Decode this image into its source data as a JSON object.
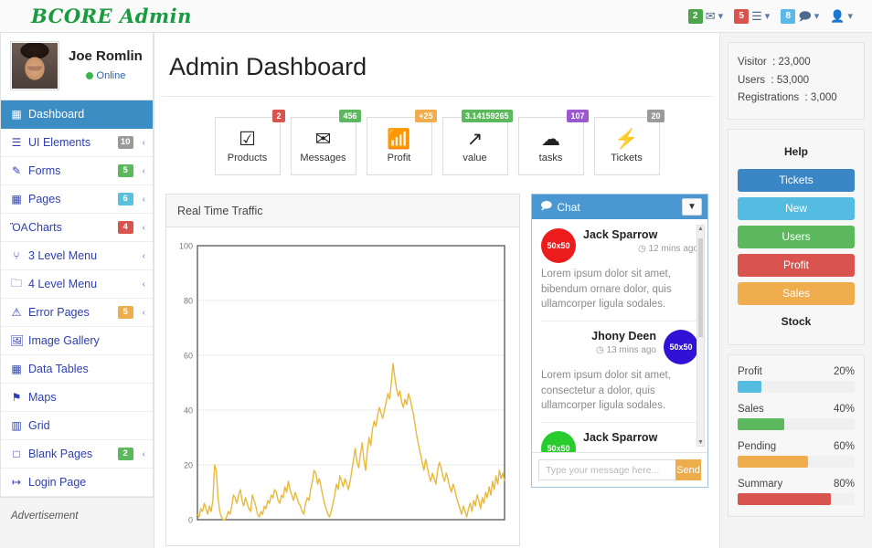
{
  "brand": "BCORE Admin",
  "topnav": [
    {
      "badge": "2",
      "badge_color": "#4ba54b",
      "icon": "envelope-icon",
      "glyph": "✉"
    },
    {
      "badge": "5",
      "badge_color": "#d9534f",
      "icon": "tasks-icon",
      "glyph": "☰"
    },
    {
      "badge": "8",
      "badge_color": "#5bb8e8",
      "icon": "comments-icon",
      "glyph": "὞9"
    },
    {
      "badge": "",
      "badge_color": "",
      "icon": "user-icon",
      "glyph": "♟"
    }
  ],
  "profile": {
    "name": "Joe Romlin",
    "status": "Online",
    "avatar": "user-avatar"
  },
  "sidebar": {
    "items": [
      {
        "label": "Dashboard",
        "icon": "grid-icon",
        "glyph": "▦",
        "badge": "",
        "badge_color": "",
        "caret": false,
        "active": true
      },
      {
        "label": "UI Elements",
        "icon": "list-icon",
        "glyph": "≡",
        "badge": "10",
        "badge_color": "#9a9a9a",
        "caret": true,
        "active": false
      },
      {
        "label": "Forms",
        "icon": "pencil-icon",
        "glyph": "✎",
        "badge": "5",
        "badge_color": "#5cb85c",
        "caret": true,
        "active": false
      },
      {
        "label": "Pages",
        "icon": "table-icon",
        "glyph": "▦",
        "badge": "6",
        "badge_color": "#5bc0de",
        "caret": true,
        "active": false
      },
      {
        "label": "Charts",
        "icon": "bar-chart-icon",
        "glyph": "ὌA",
        "badge": "4",
        "badge_color": "#d9534f",
        "caret": true,
        "active": false
      },
      {
        "label": "3 Level Menu",
        "icon": "sitemap-icon",
        "glyph": "⑂",
        "badge": "",
        "badge_color": "",
        "caret": true,
        "active": false
      },
      {
        "label": "4 Level Menu",
        "icon": "folder-icon",
        "glyph": "὜0",
        "badge": "",
        "badge_color": "",
        "caret": true,
        "active": false
      },
      {
        "label": "Error Pages",
        "icon": "warning-icon",
        "glyph": "⚠",
        "badge": "5",
        "badge_color": "#f0ad4e",
        "caret": true,
        "active": false
      },
      {
        "label": "Image Gallery",
        "icon": "image-icon",
        "glyph": "ὛC",
        "badge": "",
        "badge_color": "",
        "caret": false,
        "active": false
      },
      {
        "label": "Data Tables",
        "icon": "table-icon",
        "glyph": "▦",
        "badge": "",
        "badge_color": "",
        "caret": false,
        "active": false
      },
      {
        "label": "Maps",
        "icon": "map-pin-icon",
        "glyph": "⚑",
        "badge": "",
        "badge_color": "",
        "caret": false,
        "active": false
      },
      {
        "label": "Grid",
        "icon": "columns-icon",
        "glyph": "▥",
        "badge": "",
        "badge_color": "",
        "caret": false,
        "active": false
      },
      {
        "label": "Blank Pages",
        "icon": "square-icon",
        "glyph": "□",
        "badge": "2",
        "badge_color": "#5cb85c",
        "caret": true,
        "active": false
      },
      {
        "label": "Login Page",
        "icon": "signin-icon",
        "glyph": "↦",
        "badge": "",
        "badge_color": "",
        "caret": false,
        "active": false
      }
    ],
    "advertisement": "Advertisement"
  },
  "main": {
    "page_title": "Admin Dashboard",
    "stats": [
      {
        "label": "Products",
        "icon": "check-square-icon",
        "glyph": "☑",
        "badge": "2",
        "badge_color": "#d9534f"
      },
      {
        "label": "Messages",
        "icon": "envelope-icon",
        "glyph": "✉",
        "badge": "456",
        "badge_color": "#5cb85c"
      },
      {
        "label": "Profit",
        "icon": "signal-icon",
        "glyph": "὏6",
        "badge": "+25",
        "badge_color": "#f0ad4e"
      },
      {
        "label": "value",
        "icon": "external-link-icon",
        "glyph": "↗",
        "badge": "3.14159265",
        "badge_color": "#5cb85c"
      },
      {
        "label": "tasks",
        "icon": "cloud-icon",
        "glyph": "☁",
        "badge": "107",
        "badge_color": "#9b59d0"
      },
      {
        "label": "Tickets",
        "icon": "bolt-icon",
        "glyph": "⚡",
        "badge": "20",
        "badge_color": "#9a9a9a"
      }
    ],
    "traffic_panel_title": "Real Time Traffic",
    "chat": {
      "title": "Chat",
      "collapse_icon": "chevron-down-icon",
      "messages": [
        {
          "name": "Jack Sparrow",
          "time": "12 mins ago",
          "avatar_label": "50x50",
          "avatar_color": "#ec1c1c",
          "side": "left",
          "text": "Lorem ipsum dolor sit amet, bibendum ornare dolor, quis ullamcorper ligula sodales."
        },
        {
          "name": "Jhony Deen",
          "time": "13 mins ago",
          "avatar_label": "50x50",
          "avatar_color": "#3111d6",
          "side": "right",
          "text": "Lorem ipsum dolor sit amet, consectetur a dolor, quis ullamcorper ligula sodales."
        },
        {
          "name": "Jack Sparrow",
          "time": "",
          "avatar_label": "50x50",
          "avatar_color": "#28cc2d",
          "side": "left",
          "text": ""
        }
      ],
      "input_placeholder": "Type your message here...",
      "input_value": "",
      "send_label": "Send"
    }
  },
  "rail": {
    "stats": [
      {
        "label": "Visitor",
        "sep": ":",
        "value": "23,000"
      },
      {
        "label": "Users",
        "sep": ":",
        "value": "53,000"
      },
      {
        "label": "Registrations",
        "sep": ":",
        "value": "3,000"
      }
    ],
    "buttons": [
      {
        "label": "Help",
        "color": ""
      },
      {
        "label": "Tickets",
        "color": "#3b86c4"
      },
      {
        "label": "New",
        "color": "#54bce0"
      },
      {
        "label": "Users",
        "color": "#5cb85c"
      },
      {
        "label": "Profit",
        "color": "#d9534f"
      },
      {
        "label": "Sales",
        "color": "#f0ad4e"
      },
      {
        "label": "Stock",
        "color": ""
      }
    ],
    "bars": [
      {
        "label": "Profit",
        "percent": "20%",
        "value": 20,
        "color": "#54bce0"
      },
      {
        "label": "Sales",
        "percent": "40%",
        "value": 40,
        "color": "#5cb85c"
      },
      {
        "label": "Pending",
        "percent": "60%",
        "value": 60,
        "color": "#f0ad4e"
      },
      {
        "label": "Summary",
        "percent": "80%",
        "value": 80,
        "color": "#d9534f"
      }
    ]
  },
  "chart_data": {
    "type": "line",
    "title": "Real Time Traffic",
    "xlabel": "",
    "ylabel": "",
    "ylim": [
      0,
      100
    ],
    "yticks": [
      0,
      20,
      40,
      60,
      80,
      100
    ],
    "xticks": [],
    "grid": true,
    "line_color": "#e8b93c",
    "series": [
      {
        "name": "traffic",
        "values": [
          2,
          1,
          4,
          3,
          6,
          4,
          2,
          5,
          3,
          7,
          20,
          18,
          8,
          3,
          1,
          0,
          0,
          1,
          3,
          2,
          5,
          9,
          8,
          6,
          9,
          11,
          7,
          5,
          8,
          6,
          4,
          3,
          9,
          7,
          5,
          2,
          1,
          3,
          2,
          5,
          4,
          7,
          6,
          9,
          8,
          11,
          10,
          7,
          6,
          9,
          8,
          12,
          10,
          14,
          11,
          9,
          7,
          10,
          8,
          6,
          5,
          3,
          2,
          6,
          8,
          7,
          11,
          14,
          18,
          17,
          13,
          15,
          12,
          9,
          6,
          4,
          2,
          1,
          3,
          6,
          9,
          13,
          11,
          16,
          14,
          12,
          15,
          13,
          11,
          14,
          18,
          22,
          26,
          21,
          19,
          24,
          28,
          22,
          18,
          25,
          30,
          27,
          33,
          36,
          34,
          38,
          41,
          39,
          37,
          40,
          43,
          46,
          44,
          50,
          57,
          52,
          48,
          45,
          47,
          43,
          41,
          44,
          42,
          46,
          44,
          41,
          38,
          34,
          30,
          27,
          24,
          21,
          18,
          22,
          19,
          16,
          14,
          17,
          15,
          13,
          18,
          21,
          19,
          16,
          14,
          17,
          15,
          12,
          10,
          13,
          11,
          8,
          6,
          4,
          2,
          5,
          3,
          1,
          4,
          6,
          3,
          7,
          5,
          9,
          7,
          4,
          8,
          6,
          10,
          8,
          12,
          9,
          14,
          11,
          16,
          13,
          18,
          15,
          17,
          14
        ]
      }
    ]
  }
}
